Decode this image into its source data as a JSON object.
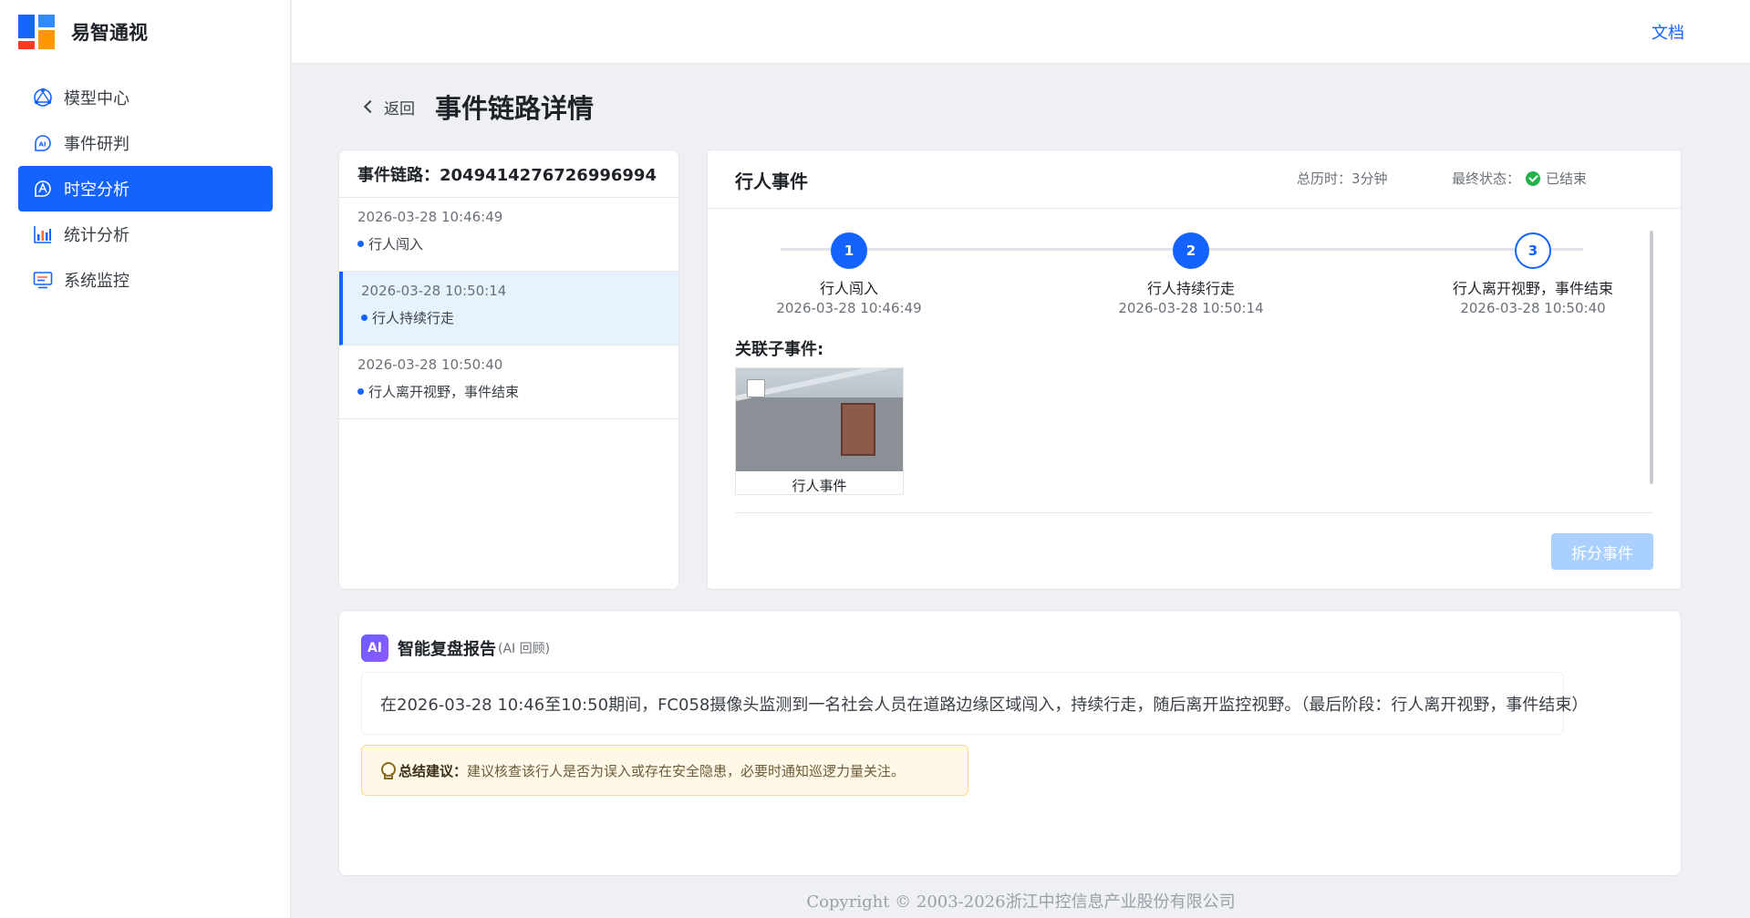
{
  "app": {
    "name": "易智通视"
  },
  "topbar": {
    "doc_label": "文档"
  },
  "sidebar": {
    "items": [
      {
        "label": "模型中心",
        "icon": "model-icon",
        "active": false
      },
      {
        "label": "事件研判",
        "icon": "ai-judge-icon",
        "active": false
      },
      {
        "label": "时空分析",
        "icon": "spacetime-icon",
        "active": true
      },
      {
        "label": "统计分析",
        "icon": "bar-chart-icon",
        "active": false
      },
      {
        "label": "系统监控",
        "icon": "monitor-icon",
        "active": false
      }
    ]
  },
  "header": {
    "back_label": "返回",
    "title": "事件链路详情"
  },
  "chain": {
    "title": "事件链路：2049414276726996994",
    "items": [
      {
        "time": "2026-03-28 10:46:49",
        "label": "行人闯入"
      },
      {
        "time": "2026-03-28 10:50:14",
        "label": "行人持续行走"
      },
      {
        "time": "2026-03-28 10:50:40",
        "label": "行人离开视野，事件结束"
      }
    ]
  },
  "event": {
    "title": "行人事件",
    "duration_label": "总历时：",
    "duration_value": "3分钟",
    "status_label": "最终状态：",
    "status_value": "已结束",
    "steps": [
      {
        "num": "1",
        "name": "行人闯入",
        "time": "2026-03-28 10:46:49"
      },
      {
        "num": "2",
        "name": "行人持续行走",
        "time": "2026-03-28 10:50:14"
      },
      {
        "num": "3",
        "name": "行人离开视野，事件结束",
        "time": "2026-03-28 10:50:40"
      }
    ],
    "related_title": "关联子事件:",
    "related": [
      {
        "label": "行人事件"
      }
    ],
    "split_label": "拆分事件"
  },
  "ai_report": {
    "badge": "AI",
    "title": "智能复盘报告",
    "subtitle": "(AI 回顾)",
    "text": "在2026-03-28 10:46至10:50期间，FC058摄像头监测到一名社会人员在道路边缘区域闯入，持续行走，随后离开监控视野。（最后阶段：行人离开视野，事件结束）",
    "tip_label": "总结建议：",
    "tip_text": "建议核查该行人是否为误入或存在安全隐患，必要时通知巡逻力量关注。"
  },
  "footer": {
    "copyright": "Copyright © 2003-2026浙江中控信息产业股份有限公司"
  },
  "colors": {
    "primary": "#1463ff",
    "success": "#22b14c",
    "tip_bg": "#fff8e6"
  }
}
